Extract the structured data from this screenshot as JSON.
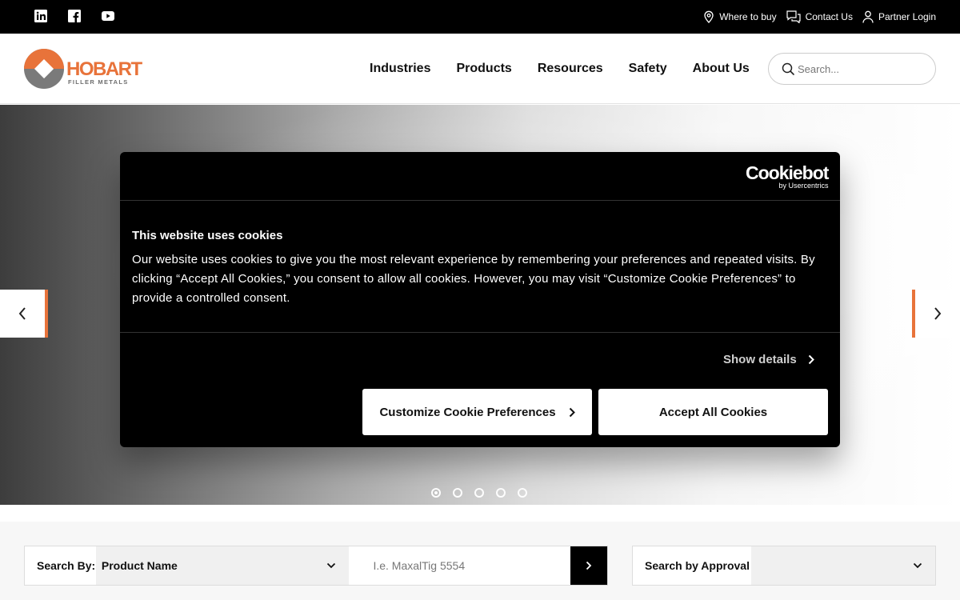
{
  "topbar": {
    "social": [
      "linkedin-icon",
      "facebook-icon",
      "youtube-icon"
    ],
    "links": [
      {
        "label": "Where to buy",
        "icon": "map-pin-icon"
      },
      {
        "label": "Contact Us",
        "icon": "chat-bubbles-icon"
      },
      {
        "label": "Partner Login",
        "icon": "user-icon"
      }
    ]
  },
  "header": {
    "logo": {
      "brand": "HOBART",
      "sub": "FILLER METALS"
    },
    "nav": [
      "Industries",
      "Products",
      "Resources",
      "Safety",
      "About Us"
    ],
    "search": {
      "placeholder": "Search..."
    }
  },
  "hero": {
    "slide_count": 5,
    "active_slide": 1
  },
  "cookie_banner": {
    "logo_main": "Cookiebot",
    "logo_sub": "by Usercentrics",
    "title": "This website uses cookies",
    "body": "Our website uses cookies to give you the most relevant experience by remembering your preferences and repeated visits. By clicking “Accept All Cookies,” you consent to allow all cookies. However, you may visit “Customize Cookie Preferences” to provide a controlled consent.",
    "show_details": "Show details",
    "customize_label": "Customize Cookie Preferences",
    "accept_label": "Accept All Cookies"
  },
  "product_search": {
    "label": "Search By:",
    "selected": "Product Name",
    "placeholder": "I.e. MaxalTig 5554"
  },
  "approval_search": {
    "label": "Search by Approval",
    "selected": ""
  },
  "colors": {
    "accent": "#e8733a",
    "topbar": "#000000",
    "dialog": "#000000"
  }
}
